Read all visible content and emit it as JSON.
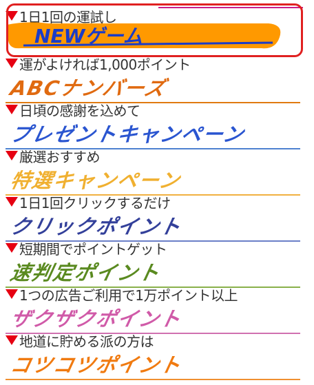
{
  "items": [
    {
      "caption": "1日1回の運試し",
      "banner": "NEWゲーム",
      "color": "#ff9900",
      "textColor": "#1a3cc8",
      "ruleColor": "#f0a000"
    },
    {
      "caption": "運がよければ1,000ポイント",
      "banner": "ABCナンバーズ",
      "color": "#ffffff",
      "textColor": "#e06a10",
      "ruleColor": "#e07a10"
    },
    {
      "caption": "日頃の感謝を込めて",
      "banner": "プレゼントキャンペーン",
      "color": "#ffffff",
      "textColor": "#2a55d0",
      "ruleColor": "#4d80d0"
    },
    {
      "caption": "厳選おすすめ",
      "banner": "特選キャンペーン",
      "color": "#ffffff",
      "textColor": "#f0b030",
      "ruleColor": "#f0b040"
    },
    {
      "caption": "1日1回クリックするだけ",
      "banner": "クリックポイント",
      "color": "#ffffff",
      "textColor": "#33409a",
      "ruleColor": "#6a7fc8"
    },
    {
      "caption": "短期間でポイントゲット",
      "banner": "速判定ポイント",
      "color": "#ffffff",
      "textColor": "#5a8a20",
      "ruleColor": "#89b04a"
    },
    {
      "caption": "1つの広告ご利用で1万ポイント以上",
      "banner": "ザクザクポイント",
      "color": "#ffffff",
      "textColor": "#d05aa8",
      "ruleColor": "#d070b0"
    },
    {
      "caption": "地道に貯める派の方は",
      "banner": "コツコツポイント",
      "color": "#ffffff",
      "textColor": "#f07a10",
      "ruleColor": "#f09030"
    }
  ]
}
